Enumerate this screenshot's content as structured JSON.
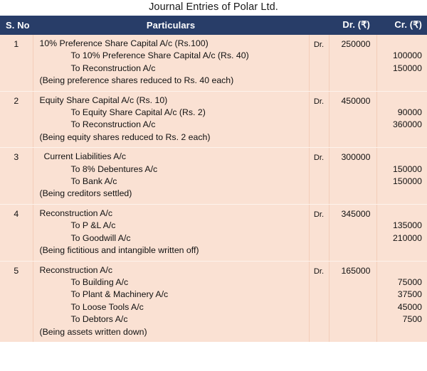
{
  "document": {
    "title": "Journal Entries of Polar Ltd."
  },
  "colors": {
    "header_bg": "#283d68",
    "header_text": "#ffffff",
    "body_bg": "#fae1d3",
    "row_divider": "#fdf3ec",
    "col_divider": "#f3cdb8",
    "text": "#111111"
  },
  "table": {
    "columns": [
      {
        "key": "sno",
        "label": "S. No",
        "align": "left"
      },
      {
        "key": "particulars",
        "label": "Particulars",
        "align": "center"
      },
      {
        "key": "drcr",
        "label": "",
        "align": "center"
      },
      {
        "key": "dr",
        "label": "Dr.  (₹)",
        "align": "right"
      },
      {
        "key": "cr",
        "label": "Cr. (₹)",
        "align": "right"
      }
    ],
    "rows": [
      {
        "sno": "1",
        "lines": [
          {
            "text": "10% Preference Share Capital A/c (Rs.100)",
            "indent": "none"
          },
          {
            "text": "To 10% Preference Share Capital A/c (Rs. 40)",
            "indent": "deep"
          },
          {
            "text": "To Reconstruction A/c",
            "indent": "deep"
          },
          {
            "text": "(Being preference shares reduced to Rs. 40 each)",
            "indent": "none"
          }
        ],
        "drcr": "Dr.",
        "dr": "250000",
        "cr": [
          "",
          "100000",
          "150000",
          ""
        ]
      },
      {
        "sno": "2",
        "lines": [
          {
            "text": "Equity Share Capital A/c (Rs. 10)",
            "indent": "none"
          },
          {
            "text": "To Equity Share Capital A/c (Rs. 2)",
            "indent": "deep"
          },
          {
            "text": "To Reconstruction A/c",
            "indent": "deep"
          },
          {
            "text": "(Being equity shares reduced to Rs. 2 each)",
            "indent": "none"
          }
        ],
        "drcr": "Dr.",
        "dr": "450000",
        "cr": [
          "",
          "90000",
          "360000",
          ""
        ]
      },
      {
        "sno": "3",
        "lines": [
          {
            "text": "Current Liabilities A/c",
            "indent": "small"
          },
          {
            "text": "To 8% Debentures A/c",
            "indent": "deep"
          },
          {
            "text": "To Bank A/c",
            "indent": "deep"
          },
          {
            "text": "(Being creditors settled)",
            "indent": "none"
          }
        ],
        "drcr": "Dr.",
        "dr": "300000",
        "cr": [
          "",
          "150000",
          "150000",
          ""
        ]
      },
      {
        "sno": "4",
        "lines": [
          {
            "text": "Reconstruction A/c",
            "indent": "none"
          },
          {
            "text": "To P &L A/c",
            "indent": "deep"
          },
          {
            "text": "To Goodwill A/c",
            "indent": "deep"
          },
          {
            "text": "(Being fictitious and intangible written off)",
            "indent": "none"
          }
        ],
        "drcr": "Dr.",
        "dr": "345000",
        "cr": [
          "",
          "135000",
          "210000",
          ""
        ]
      },
      {
        "sno": "5",
        "lines": [
          {
            "text": "Reconstruction A/c",
            "indent": "none"
          },
          {
            "text": "To Building A/c",
            "indent": "deep"
          },
          {
            "text": "To Plant & Machinery A/c",
            "indent": "deep"
          },
          {
            "text": "To Loose Tools A/c",
            "indent": "deep"
          },
          {
            "text": "To Debtors A/c",
            "indent": "deep"
          },
          {
            "text": "(Being assets written down)",
            "indent": "none"
          }
        ],
        "drcr": "Dr.",
        "dr": "165000",
        "cr": [
          "",
          "75000",
          "37500",
          "45000",
          "7500",
          ""
        ]
      }
    ]
  }
}
